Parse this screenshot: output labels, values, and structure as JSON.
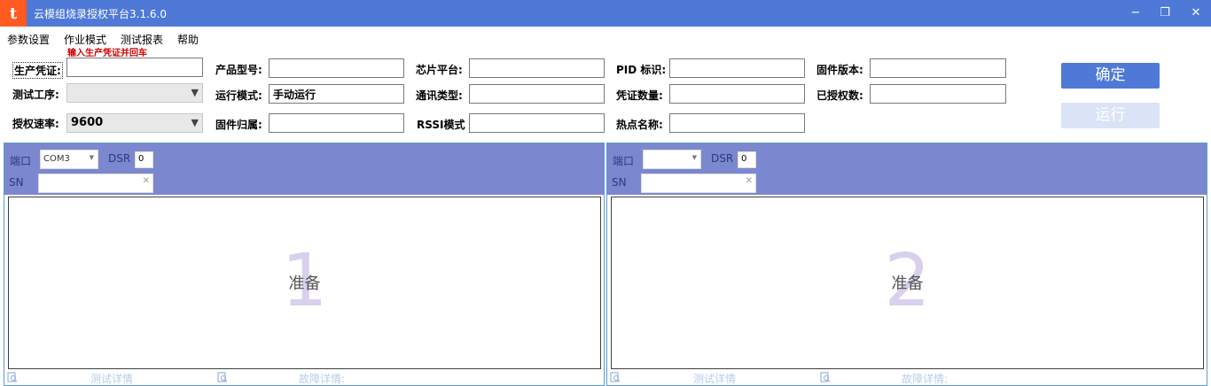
{
  "app": {
    "title": "云模组烧录授权平台3.1.6.0",
    "logo_letter": "t",
    "window_controls": {
      "minimize": "−",
      "restore": "❐",
      "close": "✕"
    }
  },
  "menu": [
    "参数设置",
    "作业模式",
    "测试报表",
    "帮助"
  ],
  "hint": "输入生产凭证并回车",
  "form": {
    "production_cert": {
      "label": "生产凭证:",
      "value": ""
    },
    "test_process": {
      "label": "测试工序:",
      "value": ""
    },
    "auth_rate": {
      "label": "授权速率:",
      "value": "9600"
    },
    "product_model": {
      "label": "产品型号:",
      "value": ""
    },
    "run_mode": {
      "label": "运行模式:",
      "value": "手动运行"
    },
    "firmware_owner": {
      "label": "固件归属:",
      "value": ""
    },
    "chip_platform": {
      "label": "芯片平台:",
      "value": ""
    },
    "comm_type": {
      "label": "通讯类型:",
      "value": ""
    },
    "rssi_mode": {
      "label": "RSSI模式",
      "value": ""
    },
    "pid": {
      "label": "PID 标识:",
      "value": ""
    },
    "cert_count": {
      "label": "凭证数量:",
      "value": ""
    },
    "hotspot_name": {
      "label": "热点名称:",
      "value": ""
    },
    "firmware_version": {
      "label": "固件版本:",
      "value": ""
    },
    "authorized_count": {
      "label": "已授权数:",
      "value": ""
    }
  },
  "buttons": {
    "confirm": "确定",
    "run": "运行"
  },
  "panels": [
    {
      "port_label": "端口",
      "port_value": "COM3",
      "dsr_label": "DSR",
      "dsr_value": "0",
      "sn_label": "SN",
      "sn_value": "",
      "number": "1",
      "status": "准备",
      "test_detail": "测试详情",
      "fault_detail": "故障详情:"
    },
    {
      "port_label": "端口",
      "port_value": "",
      "dsr_label": "DSR",
      "dsr_value": "0",
      "sn_label": "SN",
      "sn_value": "",
      "number": "2",
      "status": "准备",
      "test_detail": "测试详情",
      "fault_detail": "故障详情:"
    }
  ],
  "colors": {
    "titlebar": "#4f79d6",
    "panel_header": "#7b87cf",
    "hint": "#d00000",
    "logo": "#ff5a1f"
  }
}
